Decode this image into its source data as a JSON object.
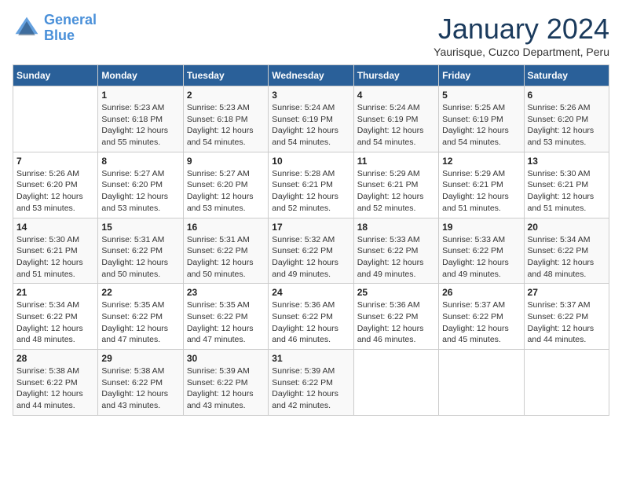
{
  "header": {
    "logo_line1": "General",
    "logo_line2": "Blue",
    "month_title": "January 2024",
    "subtitle": "Yaurisque, Cuzco Department, Peru"
  },
  "days_of_week": [
    "Sunday",
    "Monday",
    "Tuesday",
    "Wednesday",
    "Thursday",
    "Friday",
    "Saturday"
  ],
  "weeks": [
    [
      {
        "day": "",
        "info": ""
      },
      {
        "day": "1",
        "info": "Sunrise: 5:23 AM\nSunset: 6:18 PM\nDaylight: 12 hours\nand 55 minutes."
      },
      {
        "day": "2",
        "info": "Sunrise: 5:23 AM\nSunset: 6:18 PM\nDaylight: 12 hours\nand 54 minutes."
      },
      {
        "day": "3",
        "info": "Sunrise: 5:24 AM\nSunset: 6:19 PM\nDaylight: 12 hours\nand 54 minutes."
      },
      {
        "day": "4",
        "info": "Sunrise: 5:24 AM\nSunset: 6:19 PM\nDaylight: 12 hours\nand 54 minutes."
      },
      {
        "day": "5",
        "info": "Sunrise: 5:25 AM\nSunset: 6:19 PM\nDaylight: 12 hours\nand 54 minutes."
      },
      {
        "day": "6",
        "info": "Sunrise: 5:26 AM\nSunset: 6:20 PM\nDaylight: 12 hours\nand 53 minutes."
      }
    ],
    [
      {
        "day": "7",
        "info": "Sunrise: 5:26 AM\nSunset: 6:20 PM\nDaylight: 12 hours\nand 53 minutes."
      },
      {
        "day": "8",
        "info": "Sunrise: 5:27 AM\nSunset: 6:20 PM\nDaylight: 12 hours\nand 53 minutes."
      },
      {
        "day": "9",
        "info": "Sunrise: 5:27 AM\nSunset: 6:20 PM\nDaylight: 12 hours\nand 53 minutes."
      },
      {
        "day": "10",
        "info": "Sunrise: 5:28 AM\nSunset: 6:21 PM\nDaylight: 12 hours\nand 52 minutes."
      },
      {
        "day": "11",
        "info": "Sunrise: 5:29 AM\nSunset: 6:21 PM\nDaylight: 12 hours\nand 52 minutes."
      },
      {
        "day": "12",
        "info": "Sunrise: 5:29 AM\nSunset: 6:21 PM\nDaylight: 12 hours\nand 51 minutes."
      },
      {
        "day": "13",
        "info": "Sunrise: 5:30 AM\nSunset: 6:21 PM\nDaylight: 12 hours\nand 51 minutes."
      }
    ],
    [
      {
        "day": "14",
        "info": "Sunrise: 5:30 AM\nSunset: 6:21 PM\nDaylight: 12 hours\nand 51 minutes."
      },
      {
        "day": "15",
        "info": "Sunrise: 5:31 AM\nSunset: 6:22 PM\nDaylight: 12 hours\nand 50 minutes."
      },
      {
        "day": "16",
        "info": "Sunrise: 5:31 AM\nSunset: 6:22 PM\nDaylight: 12 hours\nand 50 minutes."
      },
      {
        "day": "17",
        "info": "Sunrise: 5:32 AM\nSunset: 6:22 PM\nDaylight: 12 hours\nand 49 minutes."
      },
      {
        "day": "18",
        "info": "Sunrise: 5:33 AM\nSunset: 6:22 PM\nDaylight: 12 hours\nand 49 minutes."
      },
      {
        "day": "19",
        "info": "Sunrise: 5:33 AM\nSunset: 6:22 PM\nDaylight: 12 hours\nand 49 minutes."
      },
      {
        "day": "20",
        "info": "Sunrise: 5:34 AM\nSunset: 6:22 PM\nDaylight: 12 hours\nand 48 minutes."
      }
    ],
    [
      {
        "day": "21",
        "info": "Sunrise: 5:34 AM\nSunset: 6:22 PM\nDaylight: 12 hours\nand 48 minutes."
      },
      {
        "day": "22",
        "info": "Sunrise: 5:35 AM\nSunset: 6:22 PM\nDaylight: 12 hours\nand 47 minutes."
      },
      {
        "day": "23",
        "info": "Sunrise: 5:35 AM\nSunset: 6:22 PM\nDaylight: 12 hours\nand 47 minutes."
      },
      {
        "day": "24",
        "info": "Sunrise: 5:36 AM\nSunset: 6:22 PM\nDaylight: 12 hours\nand 46 minutes."
      },
      {
        "day": "25",
        "info": "Sunrise: 5:36 AM\nSunset: 6:22 PM\nDaylight: 12 hours\nand 46 minutes."
      },
      {
        "day": "26",
        "info": "Sunrise: 5:37 AM\nSunset: 6:22 PM\nDaylight: 12 hours\nand 45 minutes."
      },
      {
        "day": "27",
        "info": "Sunrise: 5:37 AM\nSunset: 6:22 PM\nDaylight: 12 hours\nand 44 minutes."
      }
    ],
    [
      {
        "day": "28",
        "info": "Sunrise: 5:38 AM\nSunset: 6:22 PM\nDaylight: 12 hours\nand 44 minutes."
      },
      {
        "day": "29",
        "info": "Sunrise: 5:38 AM\nSunset: 6:22 PM\nDaylight: 12 hours\nand 43 minutes."
      },
      {
        "day": "30",
        "info": "Sunrise: 5:39 AM\nSunset: 6:22 PM\nDaylight: 12 hours\nand 43 minutes."
      },
      {
        "day": "31",
        "info": "Sunrise: 5:39 AM\nSunset: 6:22 PM\nDaylight: 12 hours\nand 42 minutes."
      },
      {
        "day": "",
        "info": ""
      },
      {
        "day": "",
        "info": ""
      },
      {
        "day": "",
        "info": ""
      }
    ]
  ]
}
